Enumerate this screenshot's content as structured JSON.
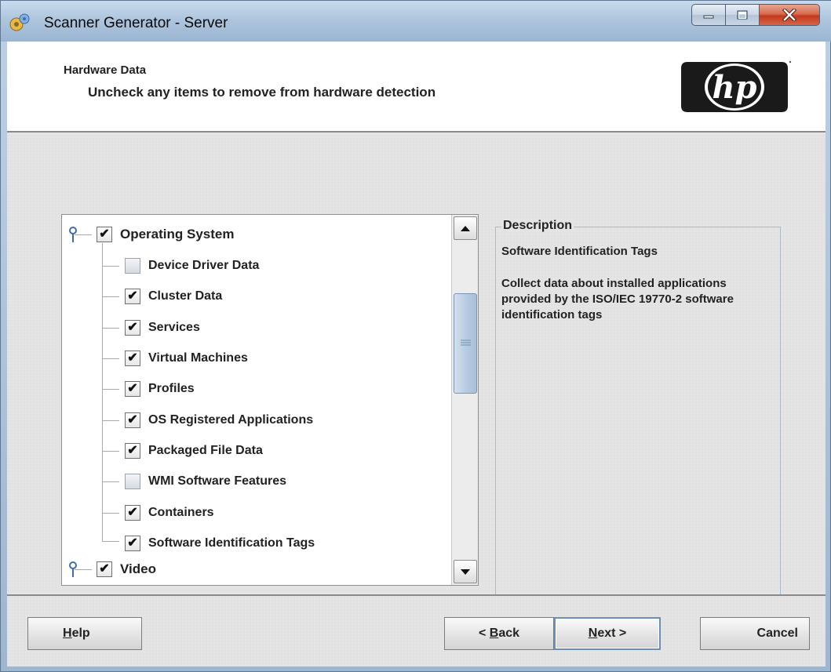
{
  "window": {
    "title": "Scanner Generator - Server"
  },
  "header": {
    "title": "Hardware Data",
    "subtitle": "Uncheck any items to remove from hardware detection",
    "logo_text": "hp"
  },
  "tree": {
    "items": [
      {
        "label": "Operating System",
        "checked": true,
        "level": 0
      },
      {
        "label": "Device Driver Data",
        "checked": false,
        "level": 1
      },
      {
        "label": "Cluster Data",
        "checked": true,
        "level": 1
      },
      {
        "label": "Services",
        "checked": true,
        "level": 1
      },
      {
        "label": "Virtual Machines",
        "checked": true,
        "level": 1
      },
      {
        "label": "Profiles",
        "checked": true,
        "level": 1
      },
      {
        "label": "OS Registered Applications",
        "checked": true,
        "level": 1
      },
      {
        "label": "Packaged File Data",
        "checked": true,
        "level": 1
      },
      {
        "label": "WMI Software Features",
        "checked": false,
        "level": 1
      },
      {
        "label": "Containers",
        "checked": true,
        "level": 1
      },
      {
        "label": "Software Identification Tags",
        "checked": true,
        "level": 1
      },
      {
        "label": "Video",
        "checked": true,
        "level": 0
      }
    ],
    "check_mark": "✔",
    "scroll_position": 0.2
  },
  "description": {
    "legend": "Description",
    "title": "Software Identification Tags",
    "text": "Collect data about installed applications provided by the ISO/IEC 19770-2 software identification tags"
  },
  "footer": {
    "help_mnemonic": "H",
    "help_rest": "elp",
    "back_prefix": "< ",
    "back_mnemonic": "B",
    "back_rest": "ack",
    "next_mnemonic": "N",
    "next_rest": "ext >",
    "cancel_label": "Cancel"
  },
  "colors": {
    "close_button": "#c2391d",
    "focus_border": "#6c8fb8",
    "scroll_thumb": "#b9cde3"
  }
}
